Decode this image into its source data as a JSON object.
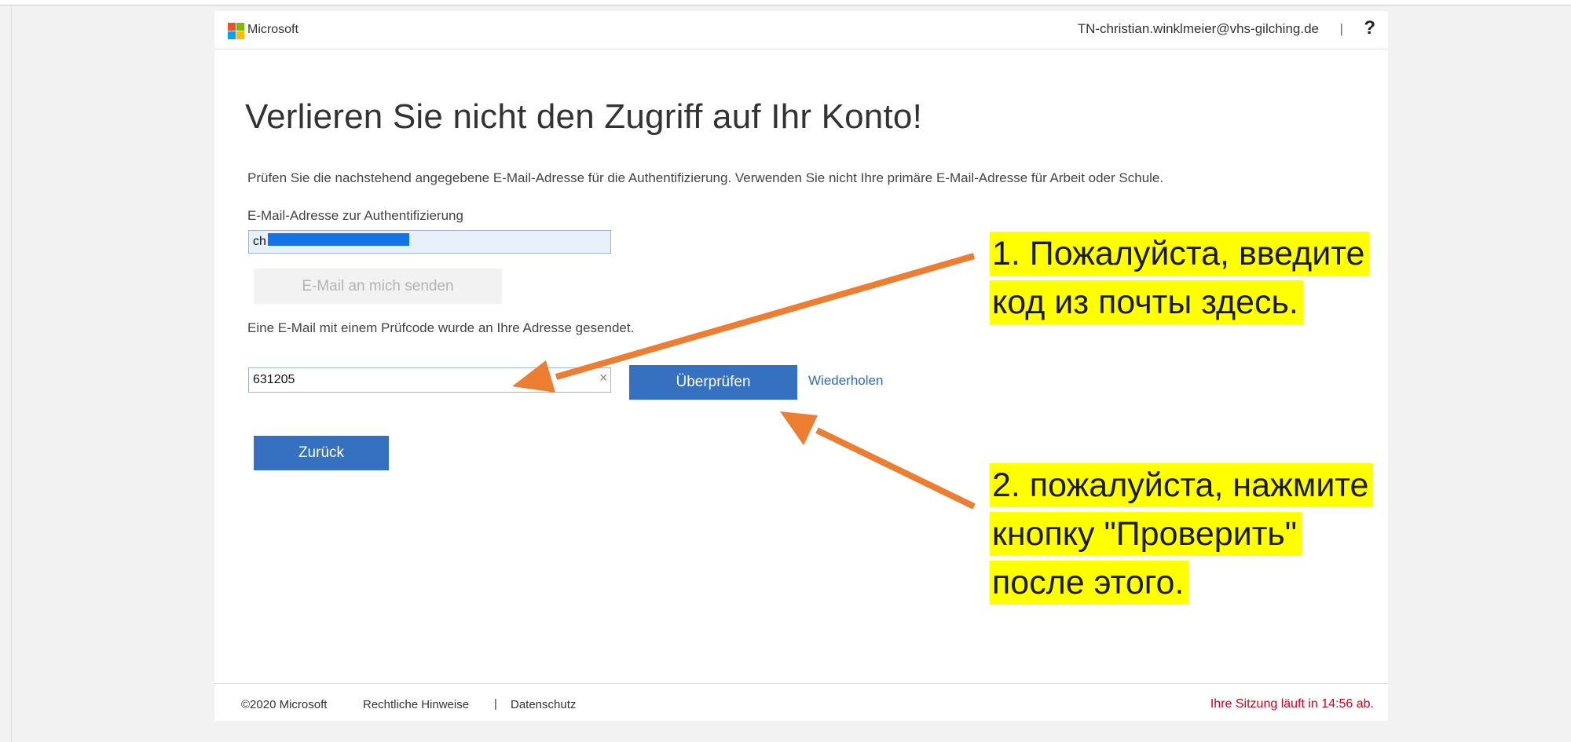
{
  "header": {
    "brand": "Microsoft",
    "account": "TN-christian.winklmeier@vhs-gilching.de",
    "separator": "|",
    "help": "?"
  },
  "main": {
    "title": "Verlieren Sie nicht den Zugriff auf Ihr Konto!",
    "description": "Prüfen Sie die nachstehend angegebene E-Mail-Adresse für die Authentifizierung. Verwenden Sie nicht Ihre primäre E-Mail-Adresse für Arbeit oder Schule.",
    "email_label": "E-Mail-Adresse zur Authentifizierung",
    "email_value": "ch",
    "send_button": "E-Mail an mich senden",
    "sent_message": "Eine E-Mail mit einem Prüfcode wurde an Ihre Adresse gesendet.",
    "code_value": "631205",
    "clear_glyph": "×",
    "verify_button": "Überprüfen",
    "retry_link": "Wiederholen",
    "back_button": "Zurück"
  },
  "footer": {
    "copyright": "©2020 Microsoft",
    "legal": "Rechtliche Hinweise",
    "separator": "|",
    "privacy": "Datenschutz",
    "session": "Ihre Sitzung läuft in 14:56 ab."
  },
  "annotations": {
    "note1_line1": "1. Пожалуйста, введите",
    "note1_line2": "код из почты здесь.",
    "note2_line1": "2. пожалуйста, нажмите",
    "note2_line2": "кнопку \"Проверить\"",
    "note2_line3": "после этого."
  },
  "colors": {
    "accent": "#3670c0",
    "arrow": "#ed7d31",
    "highlight": "#ffff00",
    "session_warning": "#d0021b"
  }
}
